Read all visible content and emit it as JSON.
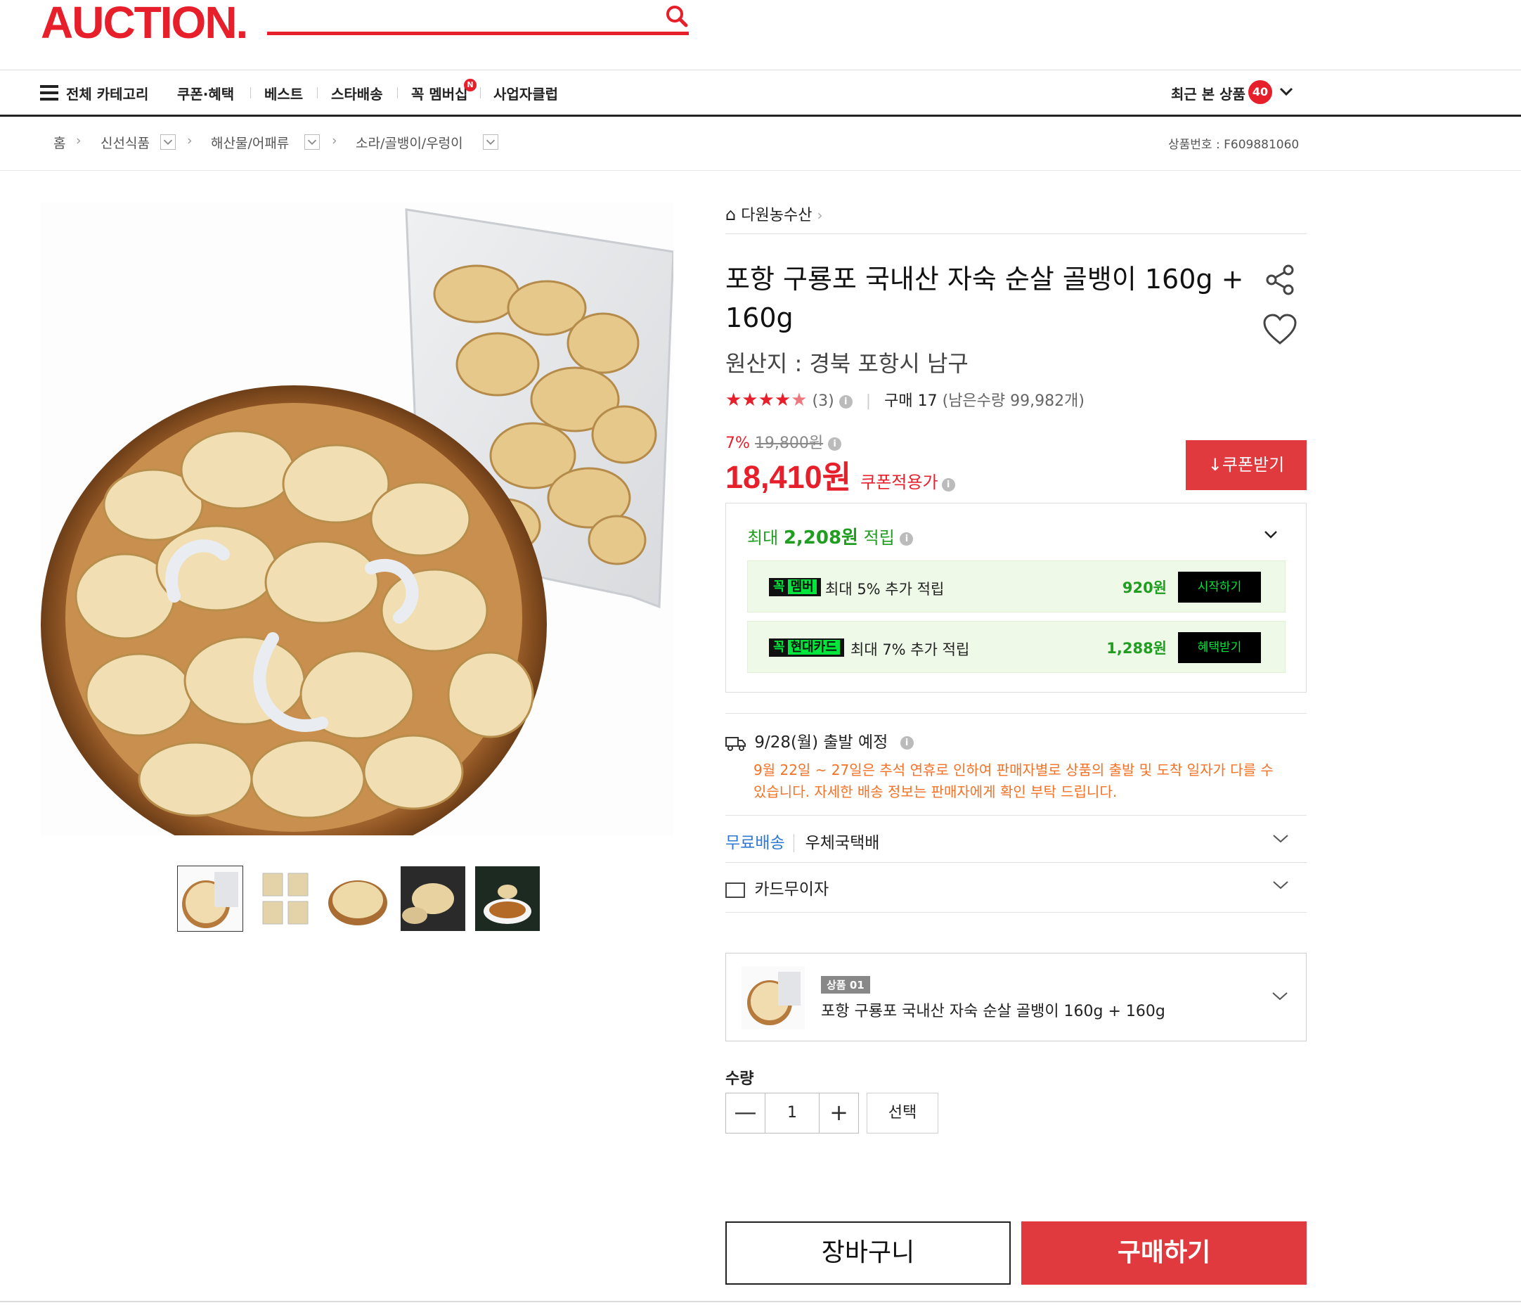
{
  "header": {
    "logo": "AUCTION.",
    "accent_color": "#e61f2b"
  },
  "nav": {
    "menu_label": "전체 카테고리",
    "items": [
      "쿠폰·혜택",
      "베스트",
      "스타배송",
      "꼭 멤버십",
      "사업자클럽"
    ],
    "new_badge": "N",
    "recent_label": "최근 본 상품",
    "recent_count": "40"
  },
  "breadcrumb": {
    "items": [
      "홈",
      "신선식품",
      "해산물/어패류",
      "소라/골뱅이/우렁이"
    ],
    "product_no": "상품번호 : F609881060"
  },
  "product": {
    "seller": "다원농수산",
    "title": "포항 구룡포 국내산 자숙 순살 골뱅이 160g + 160g",
    "origin": "원산지 : 경북 포항시 남구",
    "rating": 4.5,
    "review_count": "(3)",
    "purchase": "구매 17",
    "stock": "(남은수량 99,982개)",
    "discount_rate": "7%",
    "original_price": "19,800원",
    "price": "18,410원",
    "price_label": "쿠폰적용가",
    "coupon_button": "쿠폰받기"
  },
  "reward": {
    "title_prefix": "최대",
    "title_amount": "2,208원",
    "title_suffix": "적립",
    "rows": [
      {
        "badge_a": "꼭",
        "badge_b": "멤버",
        "text": "최대 5% 추가 적립",
        "amount": "920원",
        "button": "시작하기"
      },
      {
        "badge_a": "꼭",
        "badge_b": "현대카드",
        "text": "최대 7% 추가 적립",
        "amount": "1,288원",
        "button": "혜택받기"
      }
    ]
  },
  "shipping": {
    "date": "9/28(월) 출발 예정",
    "notice": "9월 22일 ~ 27일은 추석 연휴로 인하여 판매자별로 상품의 출발 및 도착 일자가 다를 수 있습니다. 자세한 배송 정보는 판매자에게 확인 부탁 드립니다.",
    "free": "무료배송",
    "carrier": "우체국택배",
    "card": "카드무이자"
  },
  "option": {
    "tag": "상품 01",
    "name": "포항 구룡포 국내산 자숙 순살 골뱅이 160g + 160g"
  },
  "quantity": {
    "label": "수량",
    "minus": "—",
    "value": "1",
    "plus": "+",
    "select": "선택"
  },
  "actions": {
    "cart": "장바구니",
    "buy": "구매하기"
  }
}
